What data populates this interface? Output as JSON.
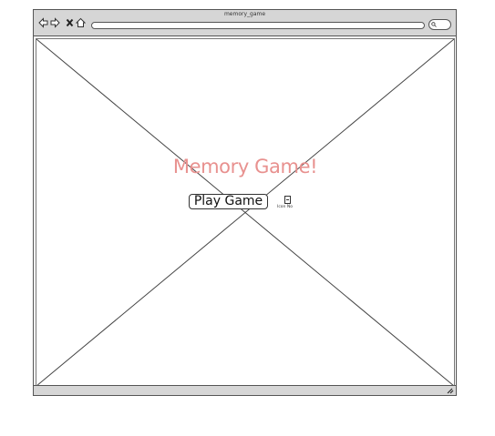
{
  "window": {
    "title": "memory_game"
  },
  "page": {
    "heading": "Memory Game!",
    "play_button": "Play Game",
    "icon_caption": "Icon No"
  },
  "colors": {
    "heading": "#e8918f",
    "chrome": "#d6d6d6"
  },
  "icons": [
    "back-icon",
    "forward-icon",
    "close-icon",
    "home-icon",
    "search-icon",
    "resize-icon",
    "image-placeholder-icon"
  ]
}
